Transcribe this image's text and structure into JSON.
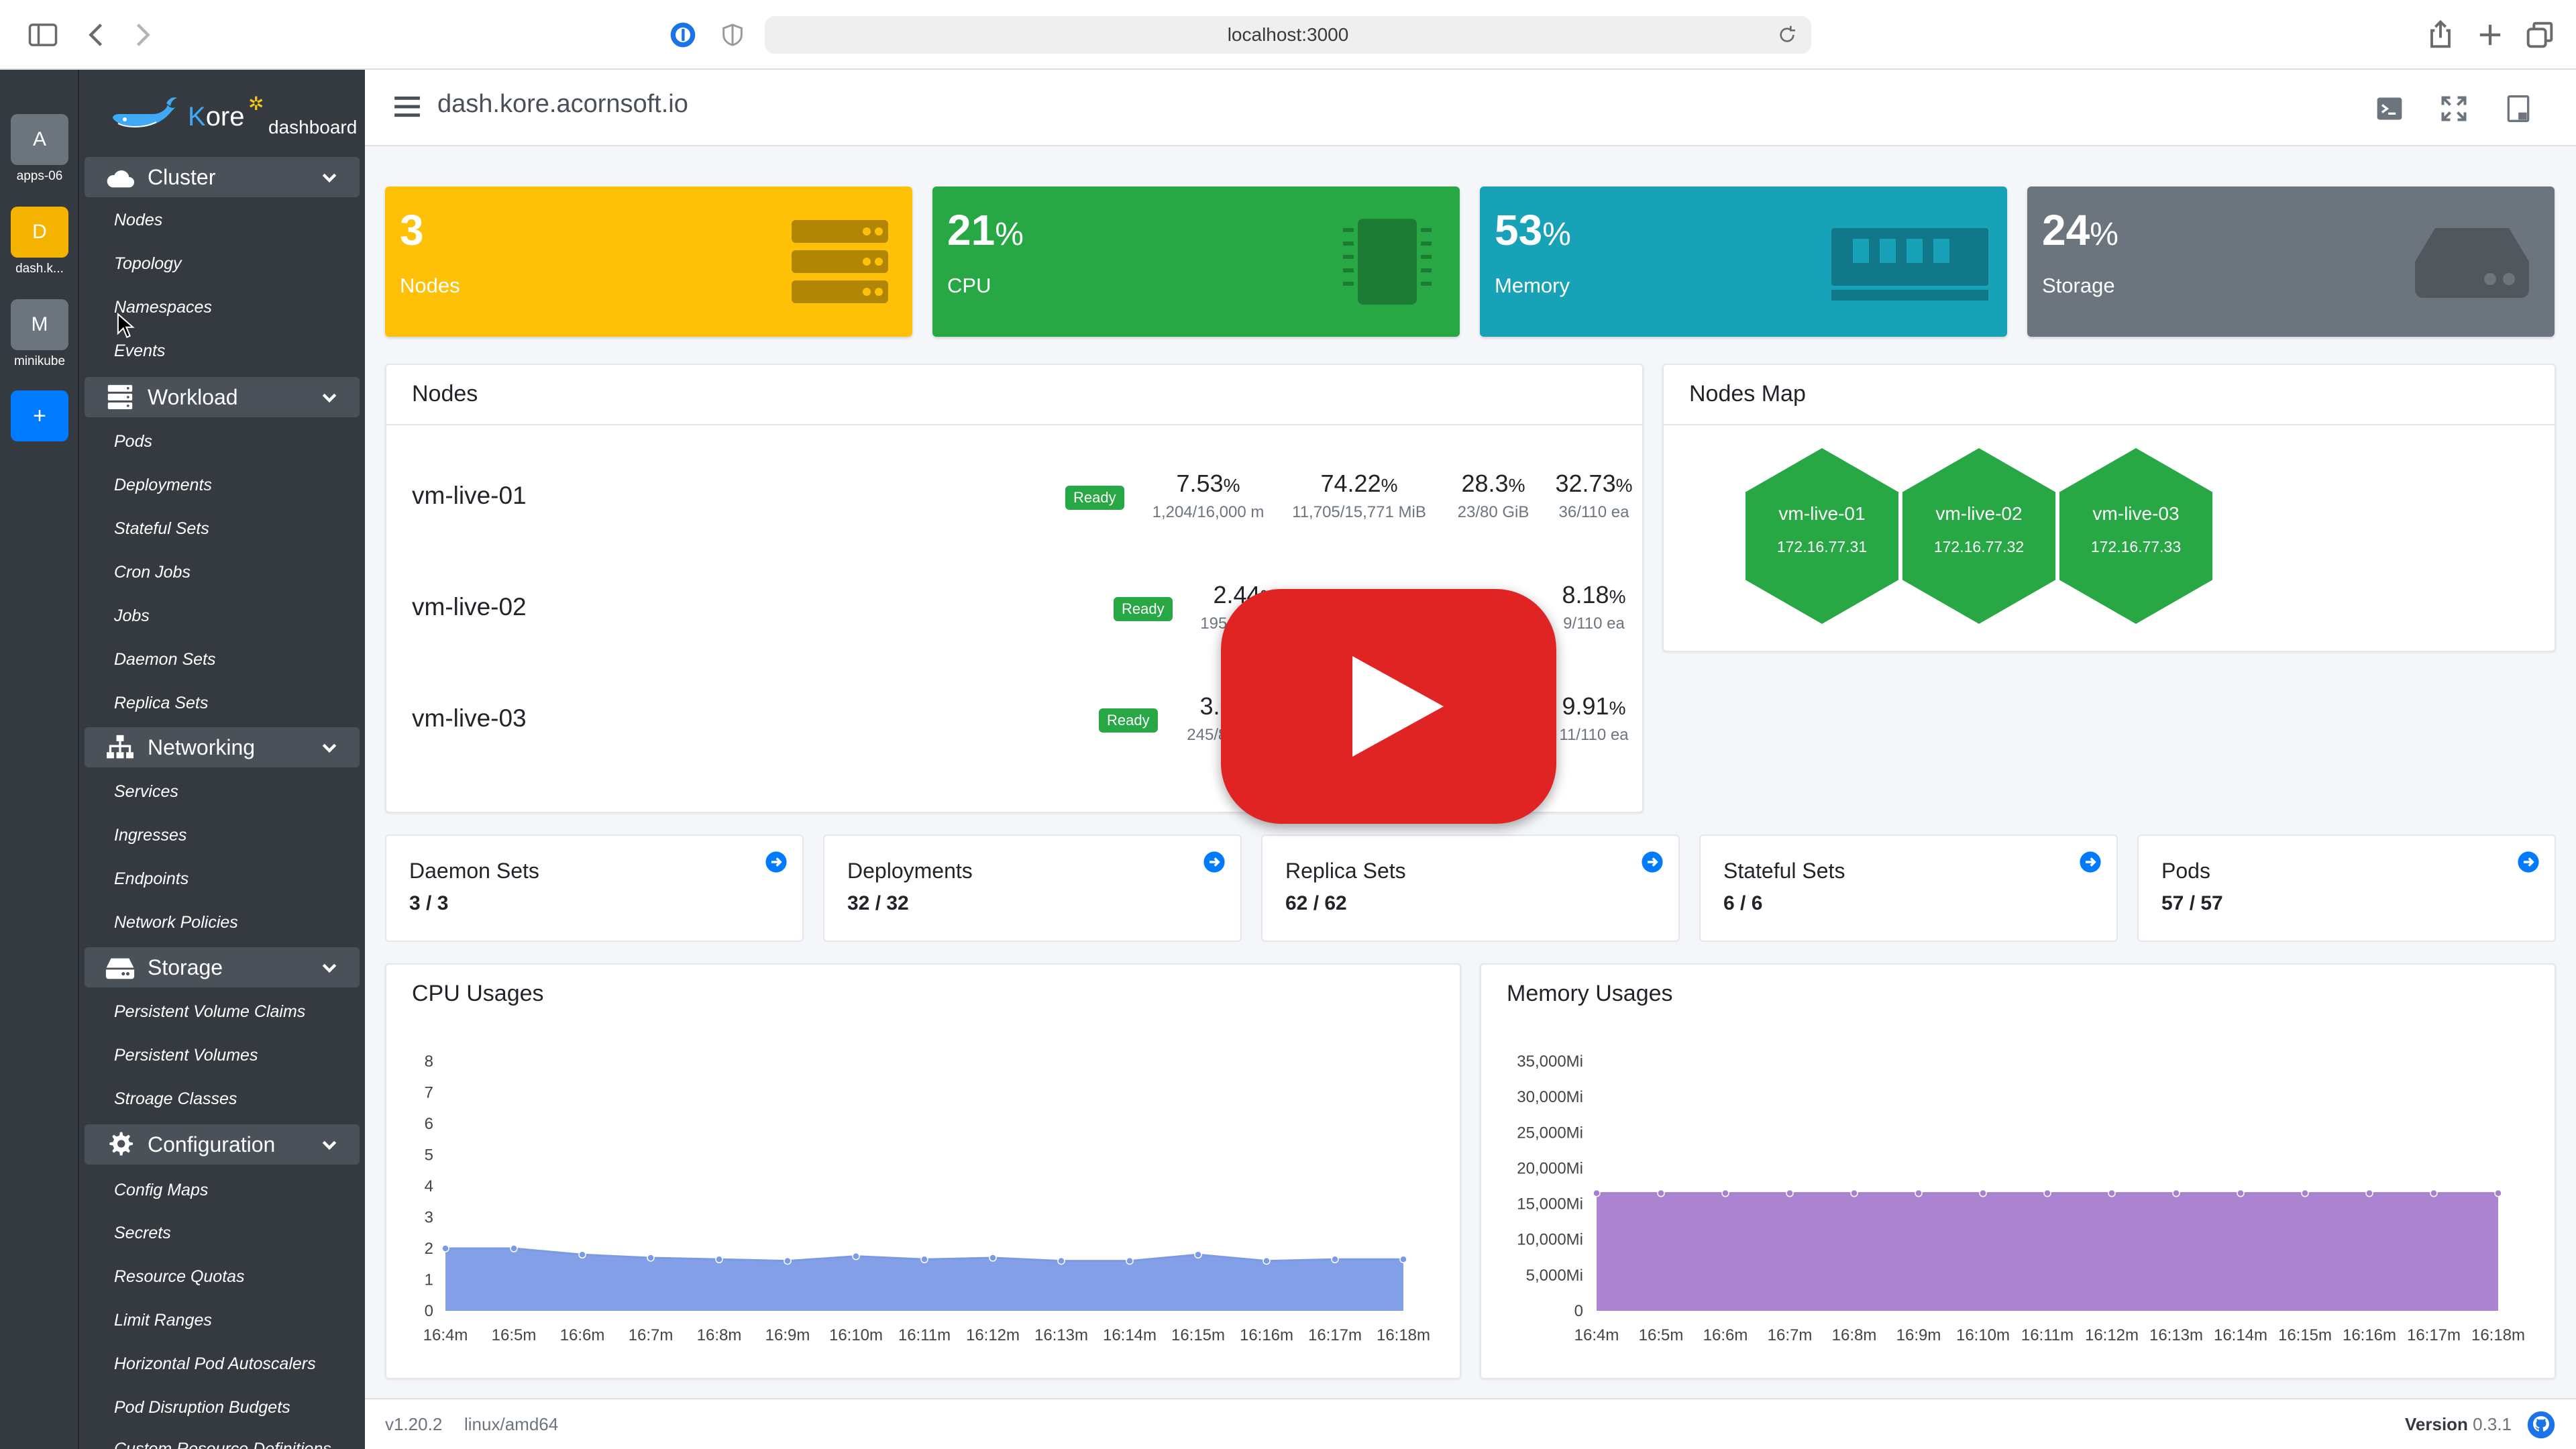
{
  "browser": {
    "url": "localhost:3000"
  },
  "rail": {
    "items": [
      {
        "letter": "A",
        "label": "apps-06",
        "color": "#6c757d"
      },
      {
        "letter": "D",
        "label": "dash.k...",
        "color": "#f5b301"
      },
      {
        "letter": "M",
        "label": "minikube",
        "color": "#6c757d"
      }
    ],
    "add_label": "+"
  },
  "brand": {
    "name_first": "K",
    "name_rest": "ore",
    "sub": "dashboard"
  },
  "sidebar": {
    "sections": [
      {
        "label": "Cluster",
        "items": [
          "Nodes",
          "Topology",
          "Namespaces",
          "Events"
        ]
      },
      {
        "label": "Workload",
        "items": [
          "Pods",
          "Deployments",
          "Stateful Sets",
          "Cron Jobs",
          "Jobs",
          "Daemon Sets",
          "Replica Sets"
        ]
      },
      {
        "label": "Networking",
        "items": [
          "Services",
          "Ingresses",
          "Endpoints",
          "Network Policies"
        ]
      },
      {
        "label": "Storage",
        "items": [
          "Persistent Volume Claims",
          "Persistent Volumes",
          "Stroage Classes"
        ]
      },
      {
        "label": "Configuration",
        "items": [
          "Config Maps",
          "Secrets",
          "Resource Quotas",
          "Limit Ranges",
          "Horizontal Pod Autoscalers",
          "Pod Disruption Budgets",
          "Custom Resource Definitions"
        ]
      }
    ]
  },
  "header": {
    "title": "dash.kore.acornsoft.io"
  },
  "stats": [
    {
      "value": "3",
      "pct": "",
      "label": "Nodes",
      "color": "#ffc107"
    },
    {
      "value": "21",
      "pct": "%",
      "label": "CPU",
      "color": "#28a745"
    },
    {
      "value": "53",
      "pct": "%",
      "label": "Memory",
      "color": "#17a2b8"
    },
    {
      "value": "24",
      "pct": "%",
      "label": "Storage",
      "color": "#6c757d"
    }
  ],
  "nodes_card": {
    "title": "Nodes",
    "ready_label": "Ready",
    "rows": [
      {
        "name": "vm-live-01",
        "cpu": "7.53",
        "cpu_sub": "1,204/16,000 m",
        "mem": "74.22",
        "mem_sub": "11,705/15,771 MiB",
        "disk": "28.3",
        "disk_sub": "23/80 GiB",
        "pods": "32.73",
        "pods_sub": "36/110 ea"
      },
      {
        "name": "vm-live-02",
        "cpu": "2.44",
        "cpu_sub": "195/8,000 m",
        "pods": "8.18",
        "pods_sub": "9/110 ea"
      },
      {
        "name": "vm-live-03",
        "cpu": "3.06",
        "cpu_sub": "245/8,000 m",
        "pods": "9.91",
        "pods_sub": "11/110 ea"
      }
    ]
  },
  "nodes_map": {
    "title": "Nodes Map",
    "nodes": [
      {
        "name": "vm-live-01",
        "ip": "172.16.77.31"
      },
      {
        "name": "vm-live-02",
        "ip": "172.16.77.32"
      },
      {
        "name": "vm-live-03",
        "ip": "172.16.77.33"
      }
    ]
  },
  "summary": [
    {
      "label": "Daemon Sets",
      "value": "3 / 3"
    },
    {
      "label": "Deployments",
      "value": "32 / 32"
    },
    {
      "label": "Replica Sets",
      "value": "62 / 62"
    },
    {
      "label": "Stateful Sets",
      "value": "6 / 6"
    },
    {
      "label": "Pods",
      "value": "57 / 57"
    }
  ],
  "chart_data": [
    {
      "type": "area",
      "title": "CPU Usages",
      "x": [
        "16:4m",
        "16:5m",
        "16:6m",
        "16:7m",
        "16:8m",
        "16:9m",
        "16:10m",
        "16:11m",
        "16:12m",
        "16:13m",
        "16:14m",
        "16:15m",
        "16:16m",
        "16:17m",
        "16:18m"
      ],
      "series": [
        {
          "values": [
            2.0,
            2.0,
            1.8,
            1.7,
            1.65,
            1.6,
            1.75,
            1.65,
            1.7,
            1.6,
            1.6,
            1.8,
            1.6,
            1.65,
            1.65
          ]
        }
      ],
      "yticks": [
        "0",
        "1",
        "2",
        "3",
        "4",
        "5",
        "6",
        "7",
        "8"
      ],
      "ylim": [
        0,
        8
      ],
      "color": "#7b9ae6"
    },
    {
      "type": "area",
      "title": "Memory Usages",
      "x": [
        "16:4m",
        "16:5m",
        "16:6m",
        "16:7m",
        "16:8m",
        "16:9m",
        "16:10m",
        "16:11m",
        "16:12m",
        "16:13m",
        "16:14m",
        "16:15m",
        "16:16m",
        "16:17m",
        "16:18m"
      ],
      "series": [
        {
          "values": [
            16500,
            16500,
            16500,
            16500,
            16500,
            16500,
            16500,
            16500,
            16500,
            16500,
            16500,
            16500,
            16500,
            16500,
            16500
          ]
        }
      ],
      "yticks": [
        "0",
        "5,000Mi",
        "10,000Mi",
        "15,000Mi",
        "20,000Mi",
        "25,000Mi",
        "30,000Mi",
        "35,000Mi"
      ],
      "ylim": [
        0,
        35000
      ],
      "color": "#a97dcf"
    }
  ],
  "footer": {
    "version_short": "v1.20.2",
    "platform": "linux/amd64",
    "version_label": "Version",
    "version_value": "0.3.1"
  }
}
